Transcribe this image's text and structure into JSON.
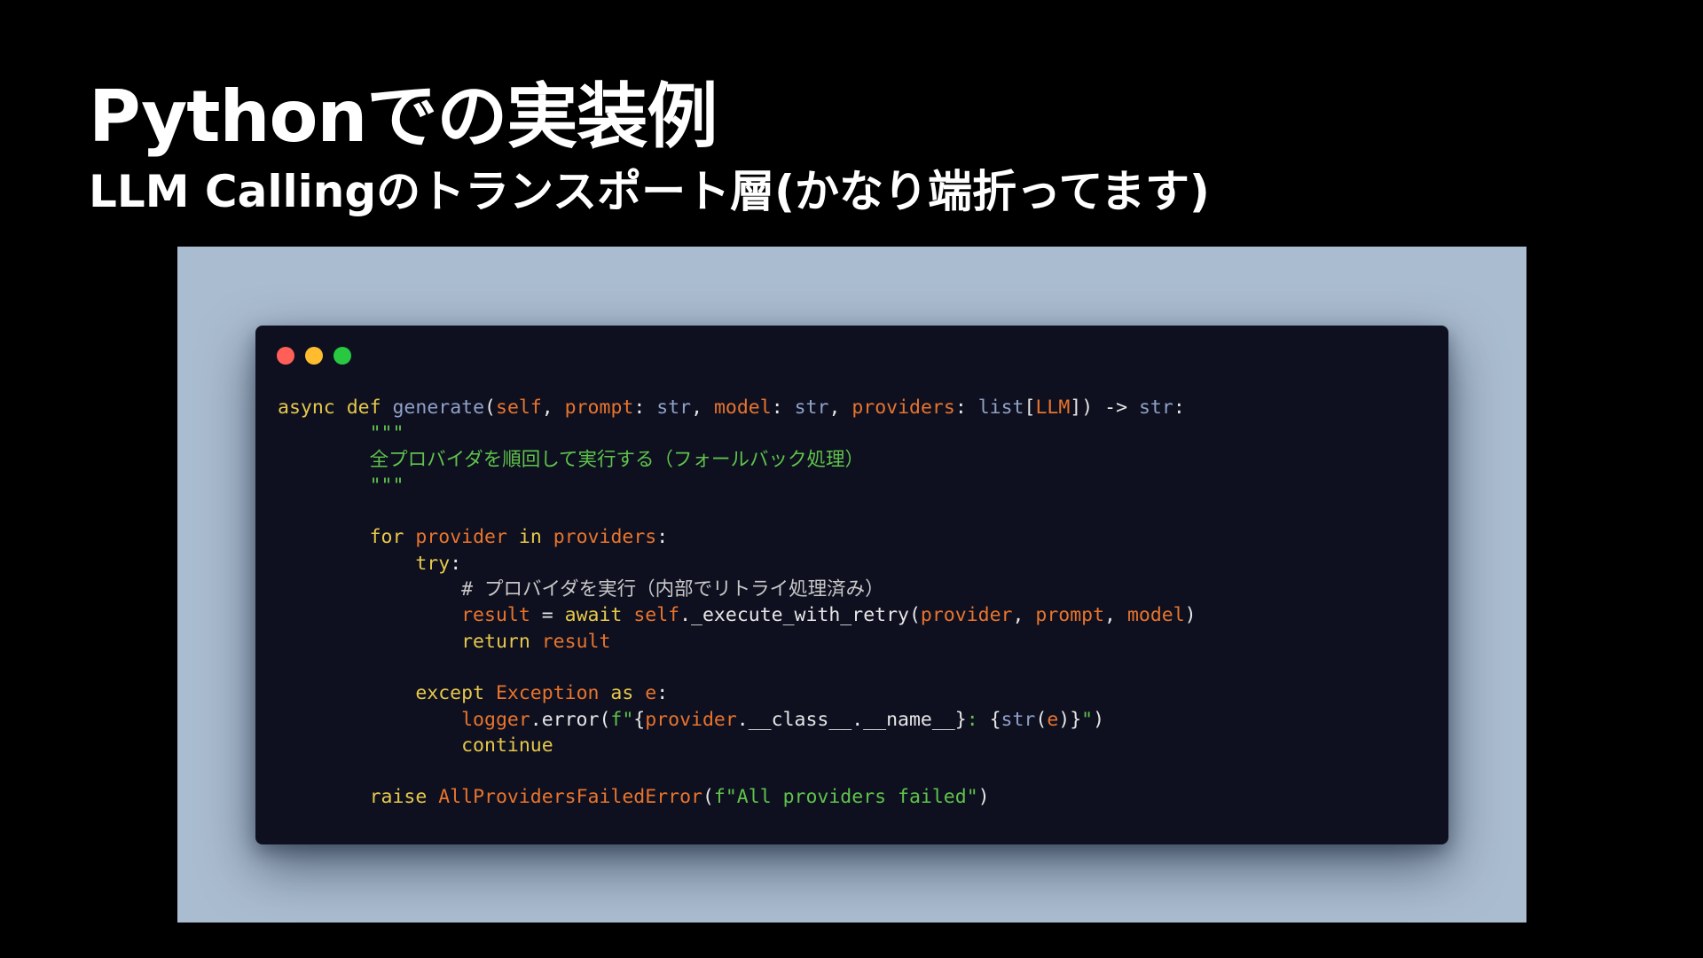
{
  "slide": {
    "title": "Pythonでの実装例",
    "subtitle": "LLM Callingのトランスポート層(かなり端折ってます)"
  },
  "window_controls": [
    {
      "name": "close-button",
      "color": "#ff5f57"
    },
    {
      "name": "minimize-button",
      "color": "#febc2e"
    },
    {
      "name": "maximize-button",
      "color": "#28c840"
    }
  ],
  "code": {
    "language": "python",
    "lines": [
      {
        "indent": "",
        "tokens": [
          {
            "t": "async",
            "c": "kw"
          },
          {
            "t": " "
          },
          {
            "t": "def",
            "c": "kw"
          },
          {
            "t": " "
          },
          {
            "t": "generate",
            "c": "fn"
          },
          {
            "t": "("
          },
          {
            "t": "self",
            "c": "var"
          },
          {
            "t": ", "
          },
          {
            "t": "prompt",
            "c": "var"
          },
          {
            "t": ": "
          },
          {
            "t": "str",
            "c": "type"
          },
          {
            "t": ", "
          },
          {
            "t": "model",
            "c": "var"
          },
          {
            "t": ": "
          },
          {
            "t": "str",
            "c": "type"
          },
          {
            "t": ", "
          },
          {
            "t": "providers",
            "c": "var"
          },
          {
            "t": ": "
          },
          {
            "t": "list",
            "c": "type"
          },
          {
            "t": "["
          },
          {
            "t": "LLM",
            "c": "var"
          },
          {
            "t": "]) -> "
          },
          {
            "t": "str",
            "c": "type"
          },
          {
            "t": ":"
          }
        ]
      },
      {
        "indent": "        ",
        "tokens": [
          {
            "t": "\"\"\"",
            "c": "str"
          }
        ]
      },
      {
        "indent": "        ",
        "tokens": [
          {
            "t": "全プロバイダを順回して実行する（フォールバック処理）",
            "c": "str"
          }
        ]
      },
      {
        "indent": "        ",
        "tokens": [
          {
            "t": "\"\"\"",
            "c": "str"
          }
        ]
      },
      {
        "indent": "",
        "tokens": []
      },
      {
        "indent": "        ",
        "tokens": [
          {
            "t": "for",
            "c": "kw"
          },
          {
            "t": " "
          },
          {
            "t": "provider",
            "c": "var"
          },
          {
            "t": " "
          },
          {
            "t": "in",
            "c": "kw"
          },
          {
            "t": " "
          },
          {
            "t": "providers",
            "c": "var"
          },
          {
            "t": ":"
          }
        ]
      },
      {
        "indent": "            ",
        "tokens": [
          {
            "t": "try",
            "c": "kw"
          },
          {
            "t": ":"
          }
        ]
      },
      {
        "indent": "                ",
        "tokens": [
          {
            "t": "# プロバイダを実行（内部でリトライ処理済み）",
            "c": "com"
          }
        ]
      },
      {
        "indent": "                ",
        "tokens": [
          {
            "t": "result",
            "c": "var"
          },
          {
            "t": " = "
          },
          {
            "t": "await",
            "c": "kw"
          },
          {
            "t": " "
          },
          {
            "t": "self",
            "c": "var"
          },
          {
            "t": "._execute_with_retry("
          },
          {
            "t": "provider",
            "c": "var"
          },
          {
            "t": ", "
          },
          {
            "t": "prompt",
            "c": "var"
          },
          {
            "t": ", "
          },
          {
            "t": "model",
            "c": "var"
          },
          {
            "t": ")"
          }
        ]
      },
      {
        "indent": "                ",
        "tokens": [
          {
            "t": "return",
            "c": "kw"
          },
          {
            "t": " "
          },
          {
            "t": "result",
            "c": "var"
          }
        ]
      },
      {
        "indent": "",
        "tokens": []
      },
      {
        "indent": "            ",
        "tokens": [
          {
            "t": "except",
            "c": "kw"
          },
          {
            "t": " "
          },
          {
            "t": "Exception",
            "c": "var"
          },
          {
            "t": " "
          },
          {
            "t": "as",
            "c": "kw"
          },
          {
            "t": " "
          },
          {
            "t": "e",
            "c": "var"
          },
          {
            "t": ":"
          }
        ]
      },
      {
        "indent": "                ",
        "tokens": [
          {
            "t": "logger",
            "c": "var"
          },
          {
            "t": ".error("
          },
          {
            "t": "f\"",
            "c": "str"
          },
          {
            "t": "{"
          },
          {
            "t": "provider",
            "c": "var"
          },
          {
            "t": ".__class__.__name__}"
          },
          {
            "t": ": ",
            "c": "str"
          },
          {
            "t": "{"
          },
          {
            "t": "str",
            "c": "type"
          },
          {
            "t": "("
          },
          {
            "t": "e",
            "c": "var"
          },
          {
            "t": ")}"
          },
          {
            "t": "\"",
            "c": "str"
          },
          {
            "t": ")"
          }
        ]
      },
      {
        "indent": "                ",
        "tokens": [
          {
            "t": "continue",
            "c": "kw"
          }
        ]
      },
      {
        "indent": "",
        "tokens": []
      },
      {
        "indent": "        ",
        "tokens": [
          {
            "t": "raise",
            "c": "kw"
          },
          {
            "t": " "
          },
          {
            "t": "AllProvidersFailedError",
            "c": "var"
          },
          {
            "t": "("
          },
          {
            "t": "f\"All providers failed\"",
            "c": "str"
          },
          {
            "t": ")"
          }
        ]
      }
    ]
  }
}
